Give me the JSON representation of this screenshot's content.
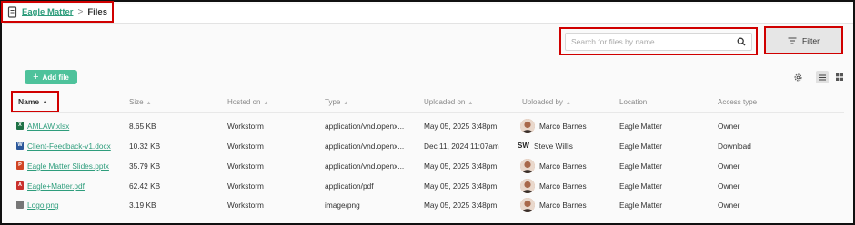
{
  "breadcrumb": {
    "parent": "Eagle Matter",
    "separator": ">",
    "current": "Files"
  },
  "search": {
    "placeholder": "Search for files by name",
    "value": ""
  },
  "filter": {
    "label": "Filter"
  },
  "toolbar": {
    "add_label": "Add file"
  },
  "columns": {
    "name": "Name",
    "size": "Size",
    "hosted_on": "Hosted on",
    "type": "Type",
    "uploaded_on": "Uploaded on",
    "uploaded_by": "Uploaded by",
    "location": "Location",
    "access_type": "Access type"
  },
  "files": [
    {
      "icon": "excel-file-icon",
      "icon_color": "#1e7145",
      "icon_letter": "X",
      "name": "AMLAW.xlsx",
      "size": "8.65 KB",
      "hosted_on": "Workstorm",
      "type": "application/vnd.openx...",
      "uploaded_on": "May 05, 2025 3:48pm",
      "uploader_initials": "",
      "uploaded_by": "Marco Barnes",
      "location": "Eagle Matter",
      "access_type": "Owner"
    },
    {
      "icon": "word-file-icon",
      "icon_color": "#2b579a",
      "icon_letter": "W",
      "name": "Client-Feedback-v1.docx",
      "size": "10.32 KB",
      "hosted_on": "Workstorm",
      "type": "application/vnd.openx...",
      "uploaded_on": "Dec 11, 2024 11:07am",
      "uploader_initials": "SW",
      "uploaded_by": "Steve Willis",
      "location": "Eagle Matter",
      "access_type": "Download"
    },
    {
      "icon": "powerpoint-file-icon",
      "icon_color": "#d04423",
      "icon_letter": "P",
      "name": "Eagle Matter Slides.pptx",
      "size": "35.79 KB",
      "hosted_on": "Workstorm",
      "type": "application/vnd.openx...",
      "uploaded_on": "May 05, 2025 3:48pm",
      "uploader_initials": "",
      "uploaded_by": "Marco Barnes",
      "location": "Eagle Matter",
      "access_type": "Owner"
    },
    {
      "icon": "pdf-file-icon",
      "icon_color": "#c9302c",
      "icon_letter": "A",
      "name": "Eagle+Matter.pdf",
      "size": "62.42 KB",
      "hosted_on": "Workstorm",
      "type": "application/pdf",
      "uploaded_on": "May 05, 2025 3:48pm",
      "uploader_initials": "",
      "uploaded_by": "Marco Barnes",
      "location": "Eagle Matter",
      "access_type": "Owner"
    },
    {
      "icon": "image-file-icon",
      "icon_color": "#777777",
      "icon_letter": "",
      "name": "Logo.png",
      "size": "3.19 KB",
      "hosted_on": "Workstorm",
      "type": "image/png",
      "uploaded_on": "May 05, 2025 3:48pm",
      "uploader_initials": "",
      "uploaded_by": "Marco Barnes",
      "location": "Eagle Matter",
      "access_type": "Owner"
    }
  ],
  "colors": {
    "accent": "#4ec29b",
    "link": "#2e9d7c",
    "highlight": "#d00000"
  }
}
